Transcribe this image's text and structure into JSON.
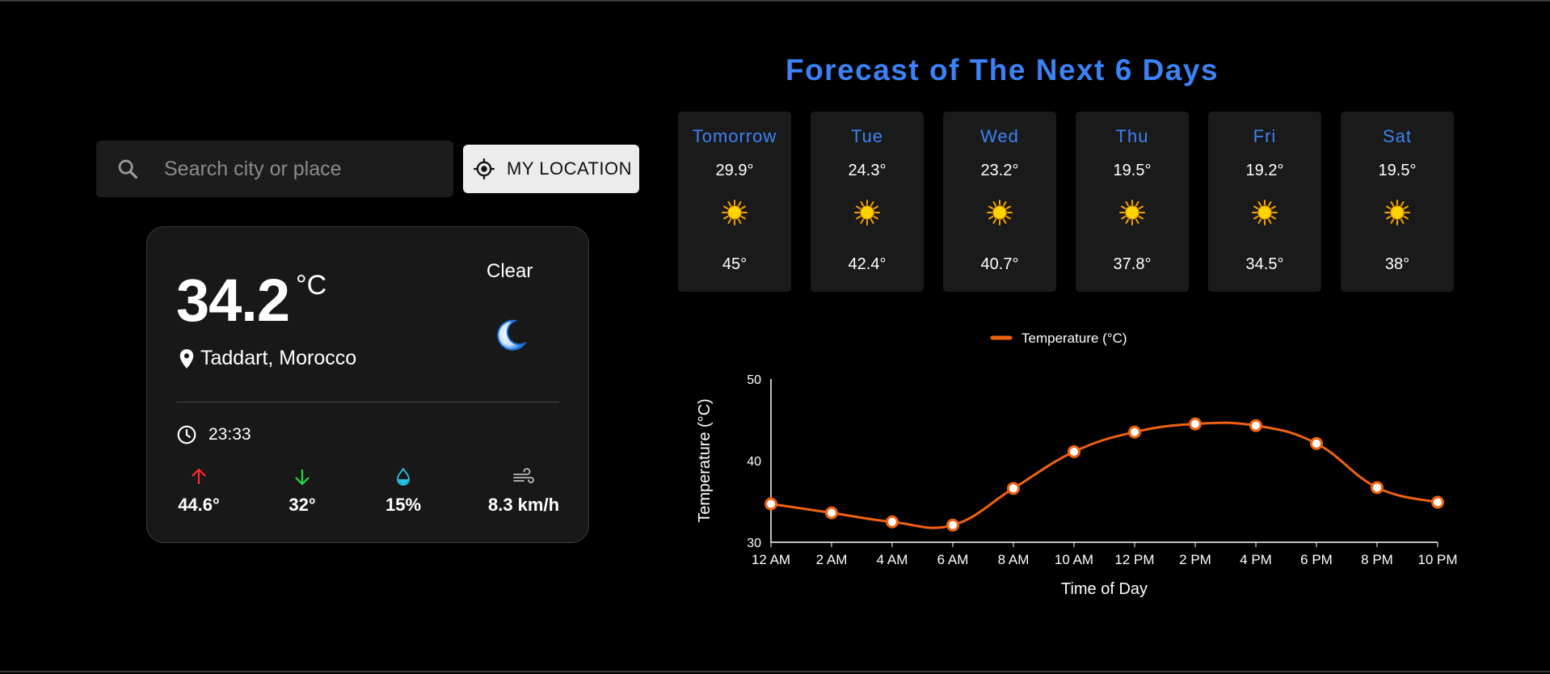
{
  "search": {
    "placeholder": "Search city or place"
  },
  "location_button": {
    "label": "MY LOCATION"
  },
  "current": {
    "temperature": "34.2",
    "unit": "°C",
    "condition": "Clear",
    "location": "Taddart, Morocco",
    "time": "23:33",
    "stats": {
      "max": "44.6°",
      "min": "32°",
      "humidity": "15%",
      "wind": "8.3 km/h"
    },
    "icons": {
      "max": "arrow-up-icon",
      "min": "arrow-down-icon",
      "humidity": "water-drop-icon",
      "wind": "wind-icon",
      "condition": "moon-icon"
    },
    "colors": {
      "max": "#ff2a2a",
      "min": "#22dd44",
      "humidity": "#22c3e6",
      "wind": "#bbbbbb"
    }
  },
  "forecast": {
    "title": "Forecast of The Next 6 Days",
    "days": [
      {
        "name": "Tomorrow",
        "hi": "29.9°",
        "lo": "45°"
      },
      {
        "name": "Tue",
        "hi": "24.3°",
        "lo": "42.4°"
      },
      {
        "name": "Wed",
        "hi": "23.2°",
        "lo": "40.7°"
      },
      {
        "name": "Thu",
        "hi": "19.5°",
        "lo": "37.8°"
      },
      {
        "name": "Fri",
        "hi": "19.2°",
        "lo": "34.5°"
      },
      {
        "name": "Sat",
        "hi": "19.5°",
        "lo": "38°"
      }
    ]
  },
  "chart_data": {
    "type": "line",
    "legend": "Temperature (°C)",
    "legend_position": "top-center",
    "xlabel": "Time of Day",
    "ylabel": "Temperature (°C)",
    "ylim": [
      30,
      50
    ],
    "yticks": [
      "50",
      "40",
      "30"
    ],
    "categories": [
      "12 AM",
      "2 AM",
      "4 AM",
      "6 AM",
      "8 AM",
      "10 AM",
      "12 PM",
      "2 PM",
      "4 PM",
      "6 PM",
      "8 PM",
      "10 PM"
    ],
    "series": [
      {
        "name": "Temperature (°C)",
        "values": [
          34.7,
          33.6,
          32.5,
          32.1,
          36.6,
          41.1,
          43.5,
          44.5,
          44.3,
          42.1,
          36.7,
          34.9
        ],
        "color": "#f0620e"
      }
    ],
    "grid": false
  }
}
